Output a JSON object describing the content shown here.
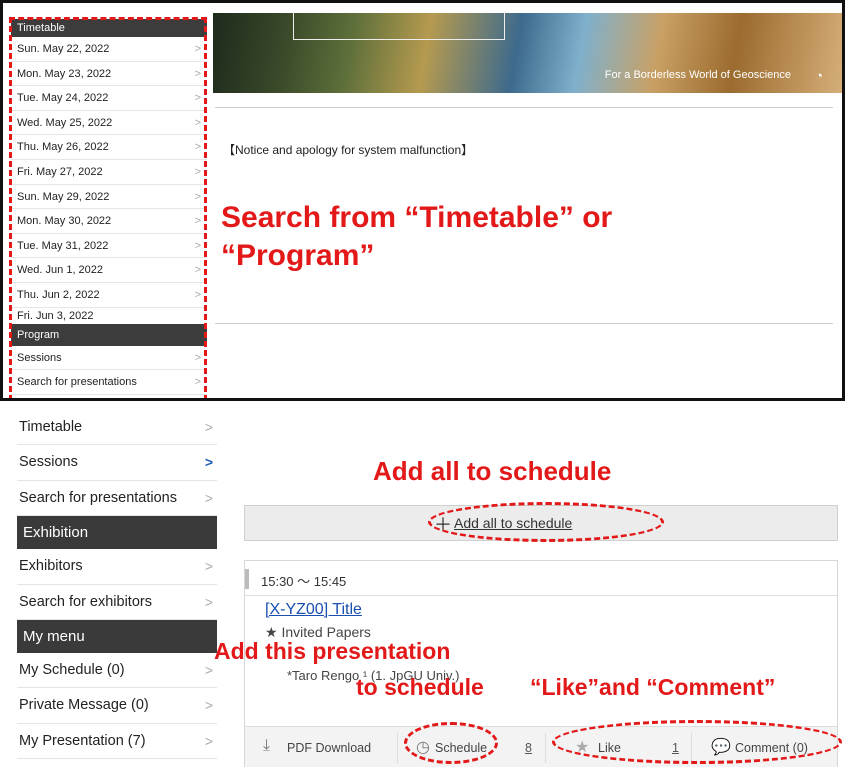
{
  "top": {
    "timetable_header": "Timetable",
    "dates": [
      "Sun. May 22, 2022",
      "Mon. May 23, 2022",
      "Tue. May 24, 2022",
      "Wed. May 25, 2022",
      "Thu. May 26, 2022",
      "Fri. May 27, 2022",
      "Sun. May 29, 2022",
      "Mon. May 30, 2022",
      "Tue. May 31, 2022",
      "Wed. Jun 1, 2022",
      "Thu. Jun 2, 2022"
    ],
    "clipped_date": "Fri. Jun 3, 2022",
    "program_header": "Program",
    "program_items": [
      "Sessions",
      "Search for presentations"
    ],
    "banner_text": "For a Borderless World of Geoscience",
    "notice": "【Notice and apology for system malfunction】",
    "search_annotation_line1": "Search from “Timetable” or",
    "search_annotation_line2": "“Program”"
  },
  "bottom": {
    "sidebar": {
      "items_a": [
        "Timetable",
        "Sessions",
        "Search for presentations"
      ],
      "exhibition_header": "Exhibition",
      "items_b": [
        "Exhibitors",
        "Search for exhibitors"
      ],
      "mymenu_header": "My menu",
      "items_c": [
        "My Schedule (0)",
        "Private Message (0)",
        "My Presentation (7)"
      ]
    },
    "add_all_annotation": "Add all to schedule",
    "add_all_label": "Add all to schedule",
    "card": {
      "time": "15:30 ～ 15:45",
      "title": "[X-YZ00] Title",
      "invited": "★ Invited Papers",
      "author": "*Taro Rengo ¹ (1. JpGU Univ.)",
      "footer": {
        "pdf": "PDF Download",
        "schedule": "Schedule",
        "schedule_count": "8",
        "like": "Like",
        "like_count": "1",
        "comment": "Comment (0)"
      }
    },
    "annot_add_this_1": "Add this presentation",
    "annot_add_this_2": "to schedule",
    "annot_like_comment": "“Like”and “Comment”"
  },
  "colors": {
    "annotation_red": "#e31818",
    "header_dark": "#3c3c3c",
    "link_blue": "#1a4fb0"
  }
}
